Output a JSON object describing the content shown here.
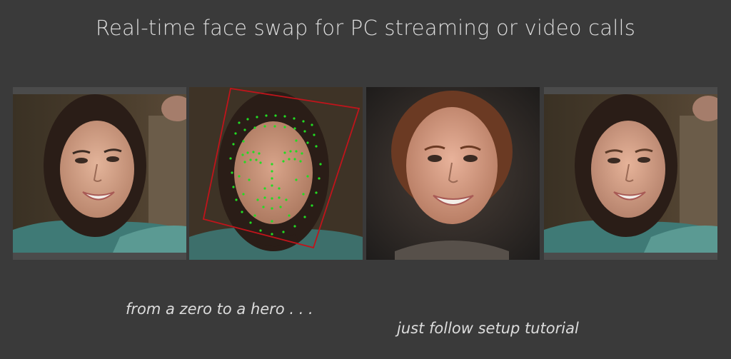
{
  "page": {
    "title": "Real-time face swap for PC streaming or video calls",
    "caption_left": "from a zero to a hero . . .",
    "caption_right": "just follow setup tutorial"
  },
  "colors": {
    "background": "#3a3a3a",
    "text": "#dcdcdc",
    "landmarks": "#22dd22",
    "bounding_box": "#c0141b"
  },
  "panels": [
    {
      "id": "source-frame",
      "description_icon": "face-photo-icon"
    },
    {
      "id": "landmark-detection",
      "description_icon": "face-landmarks-icon"
    },
    {
      "id": "swapped-face",
      "description_icon": "face-photo-icon"
    },
    {
      "id": "merged-result",
      "description_icon": "face-photo-icon"
    }
  ]
}
